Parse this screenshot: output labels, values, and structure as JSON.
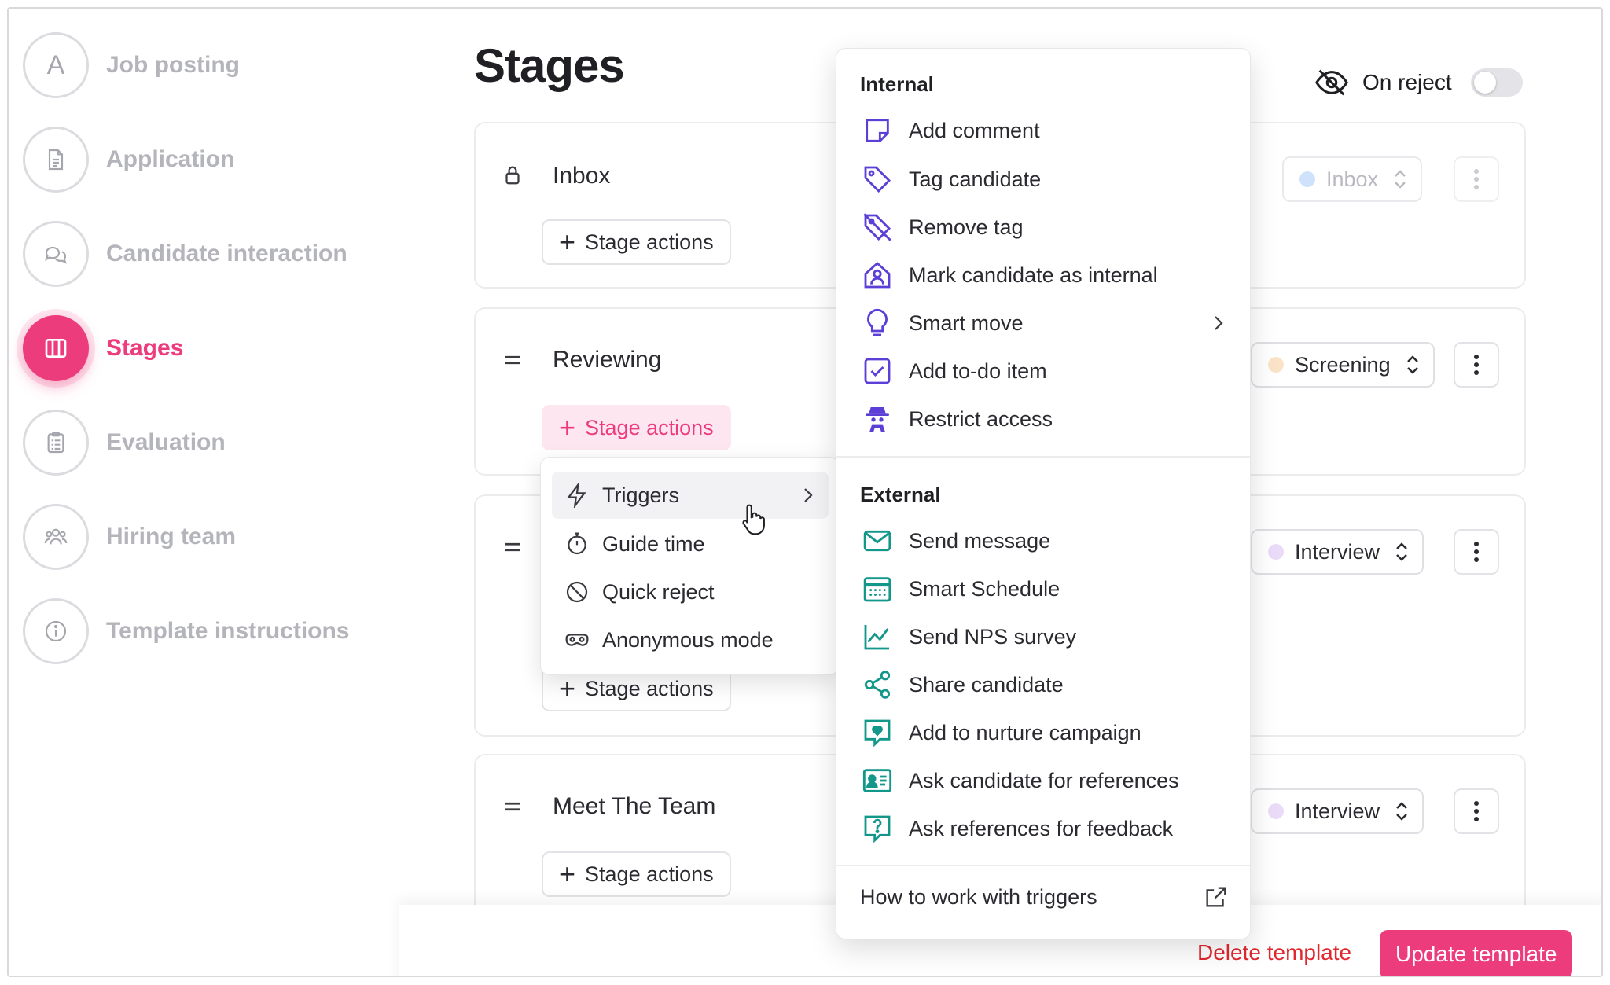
{
  "sidebar": {
    "items": [
      {
        "label": "Job posting",
        "icon": "letter-a-icon",
        "letter": "A",
        "active": false
      },
      {
        "label": "Application",
        "icon": "document-icon",
        "active": false
      },
      {
        "label": "Candidate interaction",
        "icon": "chat-bubbles-icon",
        "active": false
      },
      {
        "label": "Stages",
        "icon": "columns-icon",
        "active": true
      },
      {
        "label": "Evaluation",
        "icon": "clipboard-icon",
        "active": false
      },
      {
        "label": "Hiring team",
        "icon": "users-icon",
        "active": false
      },
      {
        "label": "Template instructions",
        "icon": "info-icon",
        "active": false
      }
    ]
  },
  "header": {
    "title": "Stages",
    "on_reject_label": "On reject",
    "on_reject_enabled": false
  },
  "stages": [
    {
      "name": "Inbox",
      "action_label": "Stage actions",
      "select_value": "Inbox",
      "select_color": "#cfe2fb",
      "locked": true
    },
    {
      "name": "Reviewing",
      "action_label": "Stage actions",
      "select_value": "Screening",
      "select_color": "#fbe3c8",
      "locked": false
    },
    {
      "name": "",
      "action_label": "Stage actions",
      "select_value": "Interview",
      "select_color": "#eadcf8",
      "locked": false
    },
    {
      "name": "Meet The Team",
      "action_label": "Stage actions",
      "select_value": "Interview",
      "select_color": "#eadcf8",
      "locked": false
    }
  ],
  "stage_menu": {
    "items": [
      {
        "label": "Triggers",
        "icon": "lightning-icon",
        "has_submenu": true
      },
      {
        "label": "Guide time",
        "icon": "stopwatch-icon"
      },
      {
        "label": "Quick reject",
        "icon": "prohibited-icon"
      },
      {
        "label": "Anonymous mode",
        "icon": "mask-icon"
      }
    ]
  },
  "triggers_menu": {
    "internal_heading": "Internal",
    "internal": [
      {
        "label": "Add comment",
        "icon": "note-icon"
      },
      {
        "label": "Tag candidate",
        "icon": "tag-icon"
      },
      {
        "label": "Remove tag",
        "icon": "tag-off-icon"
      },
      {
        "label": "Mark candidate as internal",
        "icon": "house-user-icon"
      },
      {
        "label": "Smart move",
        "icon": "lightbulb-icon",
        "has_submenu": true
      },
      {
        "label": "Add to-do item",
        "icon": "checkbox-icon"
      },
      {
        "label": "Restrict access",
        "icon": "spy-icon"
      }
    ],
    "external_heading": "External",
    "external": [
      {
        "label": "Send message",
        "icon": "envelope-icon"
      },
      {
        "label": "Smart Schedule",
        "icon": "calendar-icon"
      },
      {
        "label": "Send NPS survey",
        "icon": "chart-line-icon"
      },
      {
        "label": "Share candidate",
        "icon": "share-icon"
      },
      {
        "label": "Add to nurture campaign",
        "icon": "heart-message-icon"
      },
      {
        "label": "Ask candidate for references",
        "icon": "id-card-icon"
      },
      {
        "label": "Ask references for feedback",
        "icon": "question-message-icon"
      }
    ],
    "footer_link": "How to work with triggers"
  },
  "footer": {
    "delete_label": "Delete template",
    "update_label": "Update template"
  },
  "colors": {
    "accent": "#ec3c7c",
    "internal_icon": "#5b3fd6",
    "external_icon": "#13978a",
    "danger": "#e0282e"
  }
}
